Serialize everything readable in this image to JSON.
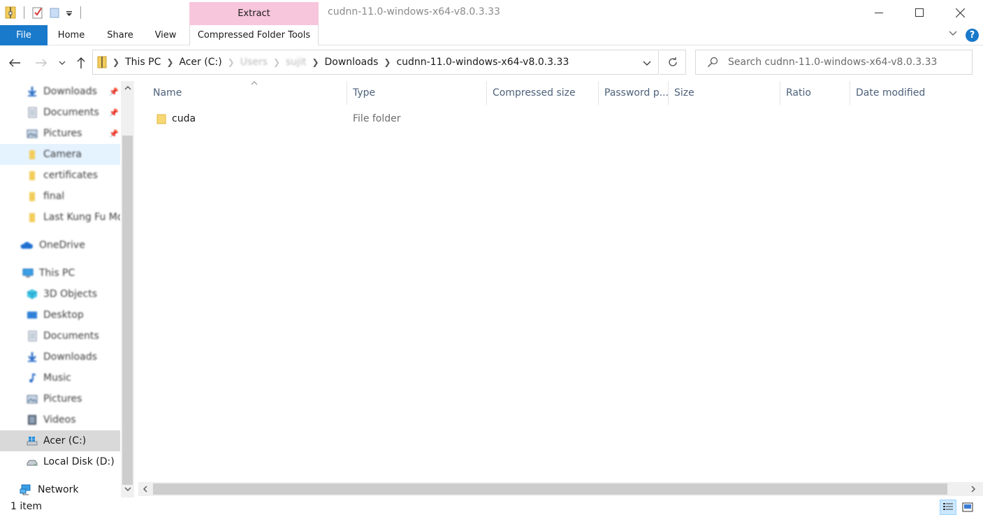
{
  "window": {
    "title": "cudnn-11.0-windows-x64-v8.0.3.33",
    "context_group": "Extract",
    "context_color": "#f7c6dc",
    "controls": {
      "minimize": "—",
      "maximize": "☐",
      "close": "✕"
    }
  },
  "ribbon": {
    "tabs": [
      {
        "label": "File"
      },
      {
        "label": "Home"
      },
      {
        "label": "Share"
      },
      {
        "label": "View"
      },
      {
        "label": "Compressed Folder Tools"
      }
    ],
    "help": "?"
  },
  "address": {
    "crumbs": [
      "This PC",
      "Acer (C:)",
      "Users",
      "sujit",
      "Downloads",
      "cudnn-11.0-windows-x64-v8.0.3.33"
    ]
  },
  "search": {
    "placeholder": "Search cudnn-11.0-windows-x64-v8.0.3.33"
  },
  "nav": {
    "items": [
      {
        "label": "Downloads",
        "icon": "download-arrow-icon",
        "pinned": true
      },
      {
        "label": "Documents",
        "icon": "document-icon",
        "pinned": true
      },
      {
        "label": "Pictures",
        "icon": "pictures-icon",
        "pinned": true
      },
      {
        "label": "Camera",
        "icon": "folder-icon",
        "pinned": false
      },
      {
        "label": "certificates",
        "icon": "folder-icon",
        "pinned": false
      },
      {
        "label": "final",
        "icon": "folder-icon",
        "pinned": false
      },
      {
        "label": "Last Kung Fu Mo",
        "icon": "folder-icon",
        "pinned": false
      },
      {
        "label": "OneDrive",
        "icon": "cloud-icon",
        "pinned": false
      },
      {
        "label": "This PC",
        "icon": "computer-icon",
        "pinned": false
      },
      {
        "label": "3D Objects",
        "icon": "cube-icon",
        "pinned": false
      },
      {
        "label": "Desktop",
        "icon": "desktop-icon",
        "pinned": false
      },
      {
        "label": "Documents",
        "icon": "document-icon",
        "pinned": false
      },
      {
        "label": "Downloads",
        "icon": "download-arrow-icon",
        "pinned": false
      },
      {
        "label": "Music",
        "icon": "music-note-icon",
        "pinned": false
      },
      {
        "label": "Pictures",
        "icon": "pictures-icon",
        "pinned": false
      },
      {
        "label": "Videos",
        "icon": "film-icon",
        "pinned": false
      },
      {
        "label": "Acer (C:)",
        "icon": "windows-drive-icon",
        "pinned": false
      },
      {
        "label": "Local Disk (D:)",
        "icon": "drive-icon",
        "pinned": false
      },
      {
        "label": "Network",
        "icon": "network-icon",
        "pinned": false
      }
    ]
  },
  "filelist": {
    "columns": [
      "Name",
      "Type",
      "Compressed size",
      "Password p...",
      "Size",
      "Ratio",
      "Date modified"
    ],
    "rows": [
      {
        "name": "cuda",
        "type": "File folder",
        "compressed_size": "",
        "password": "",
        "size": "",
        "ratio": "",
        "date_modified": ""
      }
    ]
  },
  "status": {
    "item_count": "1 item"
  }
}
